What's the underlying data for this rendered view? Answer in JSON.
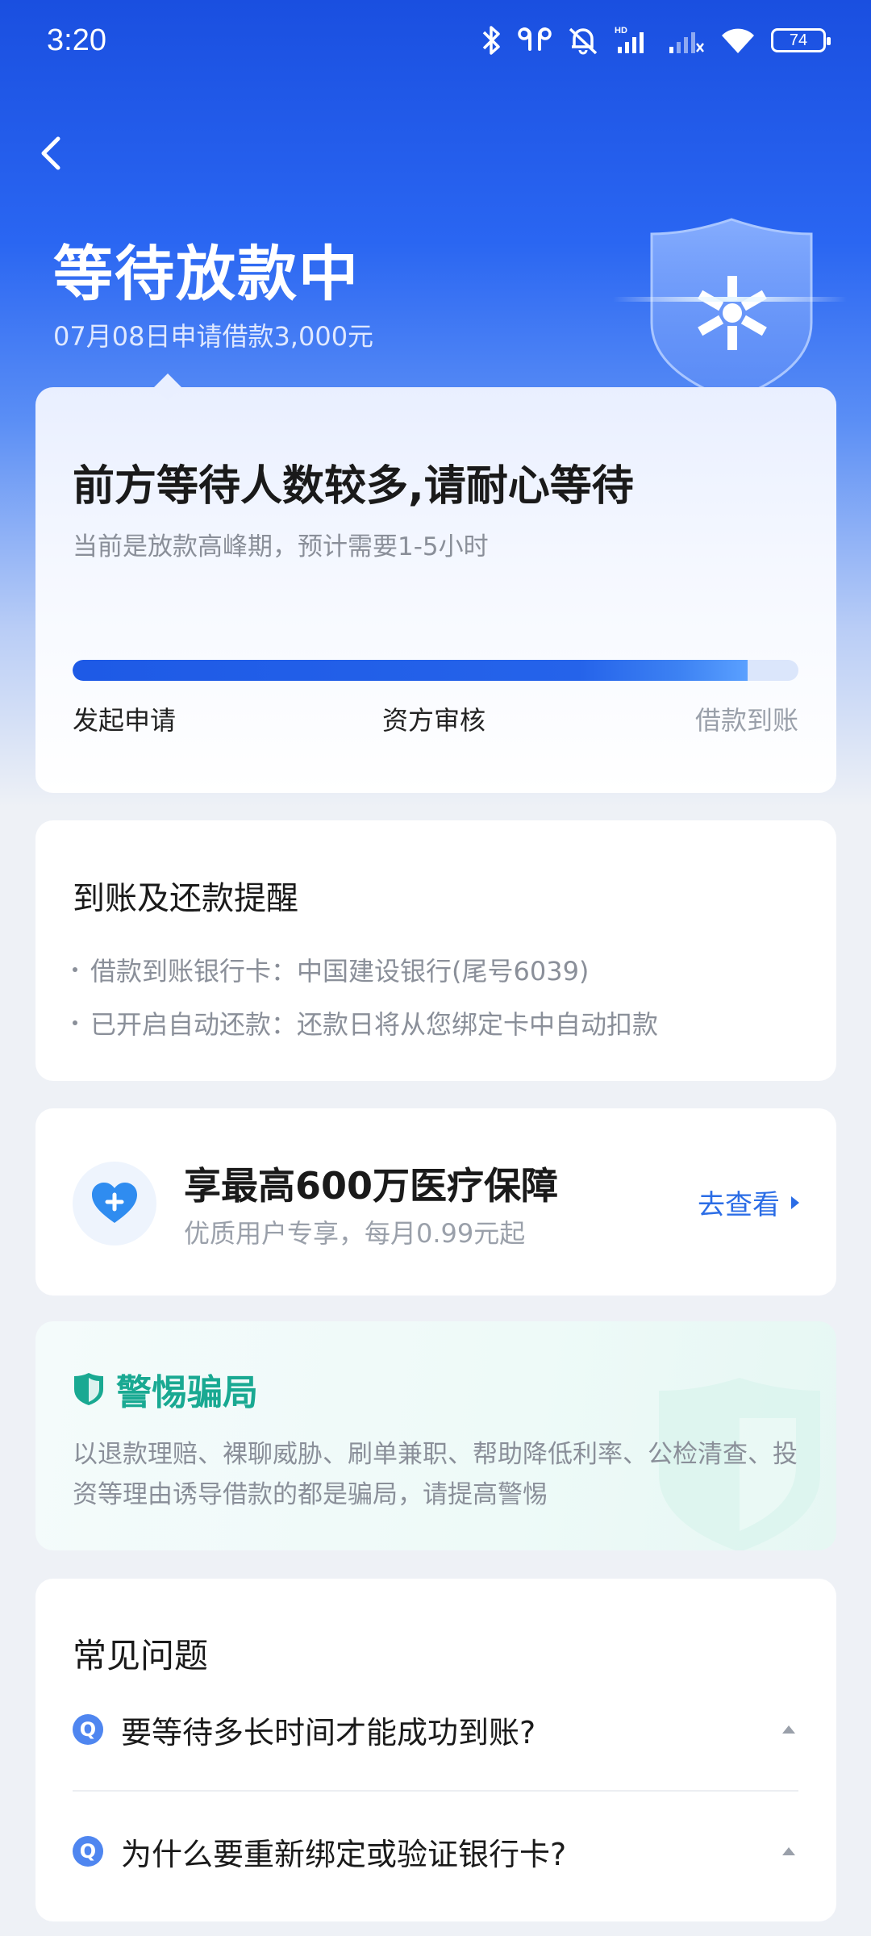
{
  "status_bar": {
    "time": "3:20",
    "battery": "74"
  },
  "header": {
    "title": "等待放款中",
    "subtitle": "07月08日申请借款3,000元"
  },
  "status_card": {
    "heading": "前方等待人数较多,请耐心等待",
    "note": "当前是放款高峰期，预计需要1-5小时",
    "progress_percent": 93,
    "steps": [
      "发起申请",
      "资方审核",
      "借款到账"
    ]
  },
  "reminder_card": {
    "title": "到账及还款提醒",
    "items": [
      "借款到账银行卡：中国建设银行(尾号6039)",
      "已开启自动还款：还款日将从您绑定卡中自动扣款"
    ]
  },
  "insurance_card": {
    "title": "享最高600万医疗保障",
    "subtitle": "优质用户专享，每月0.99元起",
    "link": "去查看"
  },
  "fraud_card": {
    "title": "警惕骗局",
    "text": "以退款理赔、裸聊威胁、刷单兼职、帮助降低利率、公检清查、投资等理由诱导借款的都是骗局，请提高警惕"
  },
  "faq_card": {
    "title": "常见问题",
    "badge": "Q",
    "questions": [
      "要等待多长时间才能成功到账?",
      "为什么要重新绑定或验证银行卡?"
    ]
  },
  "colors": {
    "brand_blue": "#1a4fe0",
    "link_blue": "#2b6de6",
    "fraud_green": "#19a992"
  }
}
